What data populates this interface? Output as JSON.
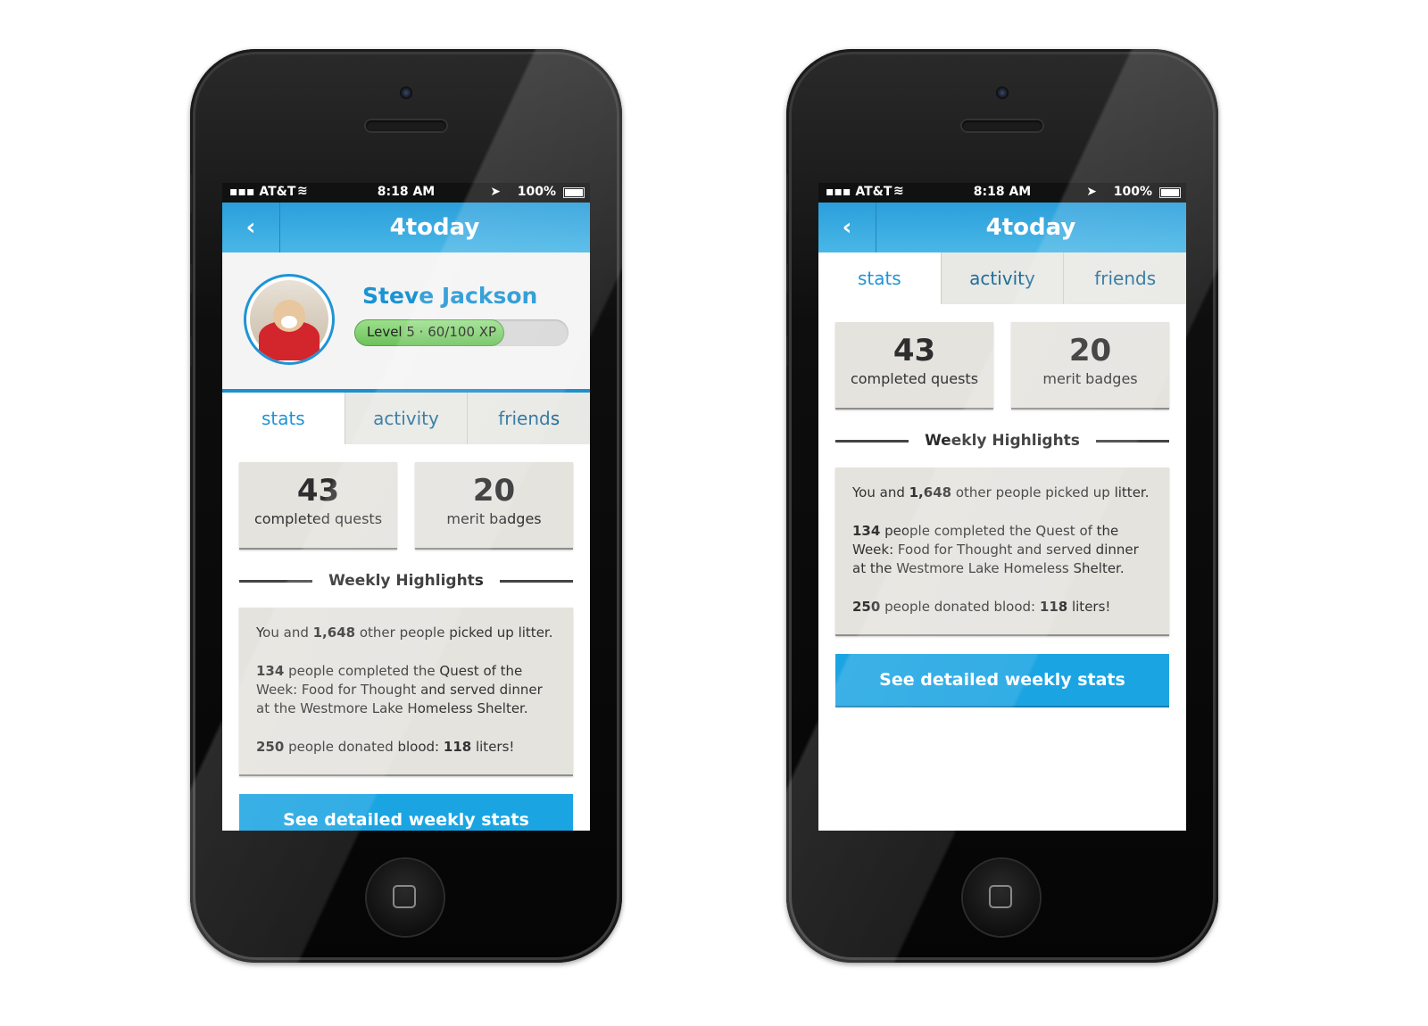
{
  "status": {
    "carrier": "AT&T",
    "time": "8:18 AM",
    "battery": "100%"
  },
  "app": {
    "title": "4today",
    "back_icon": "chevron-left-icon"
  },
  "profile": {
    "name": "Steve Jackson",
    "level_text": "Level 5  · 60/100 XP",
    "xp_current": 60,
    "xp_max": 100
  },
  "tabs": [
    {
      "label": "stats"
    },
    {
      "label": "activity"
    },
    {
      "label": "friends"
    }
  ],
  "stats": {
    "quests_count": "43",
    "quests_label": "completed quests",
    "badges_count": "20",
    "badges_label": "merit badges"
  },
  "highlights": {
    "title": "Weekly Highlights",
    "item1_pre": "You and ",
    "item1_bold": "1,648",
    "item1_post": " other people picked up litter.",
    "item2_bold": "134",
    "item2_post": " people completed the Quest of the Week: Food for Thought and served dinner at the Westmore Lake Homeless Shelter.",
    "item3_bold1": "250",
    "item3_mid": " people donated blood: ",
    "item3_bold2": "118",
    "item3_post": " liters!"
  },
  "cta": {
    "label": "See detailed weekly stats"
  },
  "colors": {
    "accent": "#1e94d5",
    "navbar": "#2b9fdb",
    "xp_fill": "#7fcd6d",
    "card_bg": "#e4e3de"
  }
}
